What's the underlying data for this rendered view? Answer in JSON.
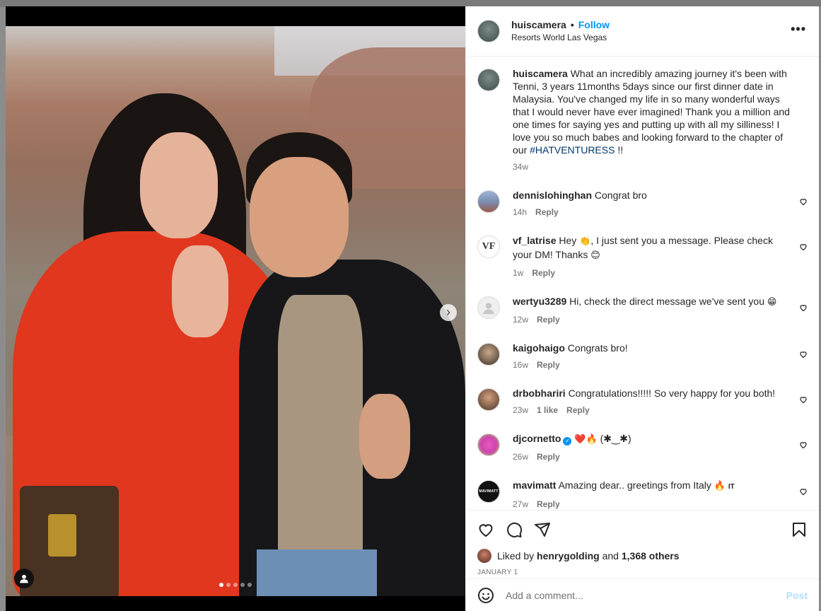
{
  "post": {
    "username": "huiscamera",
    "separator": "•",
    "follow_label": "Follow",
    "location": "Resorts World Las Vegas",
    "more_label": "•••"
  },
  "caption": {
    "username": "huiscamera",
    "text": "What an incredibly amazing journey it's been with Tenni, 3 years 11months 5days since our first dinner date in Malaysia. You've changed my life in so many wonderful ways that I would never have ever imagined! Thank you a million and one times for saying yes and putting up with all my silliness! I love you so much babes and looking forward to the chapter of our ",
    "hashtag": "#HATVENTURESS",
    "suffix": " !!",
    "time": "34w"
  },
  "comments": [
    {
      "username": "dennislohinghan",
      "text": "Congrat bro",
      "time": "14h",
      "reply": "Reply",
      "likes": ""
    },
    {
      "username": "vf_latrise",
      "text_a": "Hey",
      "emoji_a": "👏",
      "text_b": ", I just sent you a message. Please check your DM! Thanks",
      "emoji_b": "😊",
      "time": "1w",
      "reply": "Reply",
      "likes": "",
      "avatar_text": "VF"
    },
    {
      "username": "wertyu3289",
      "text": "Hi, check the direct message we've sent you",
      "emoji": "😁",
      "time": "12w",
      "reply": "Reply",
      "likes": ""
    },
    {
      "username": "kaigohaigo",
      "text": "Congrats bro!",
      "time": "16w",
      "reply": "Reply",
      "likes": ""
    },
    {
      "username": "drbobhariri",
      "text": "Congratulations!!!!! So very happy for you both!",
      "time": "23w",
      "reply": "Reply",
      "likes": "1 like"
    },
    {
      "username": "djcornetto",
      "verified": "✓",
      "emoji": "❤️🔥",
      "text": " (✱‿✱)",
      "time": "26w",
      "reply": "Reply",
      "likes": ""
    },
    {
      "username": "mavimatt",
      "text": "Amazing dear.. greetings from Italy",
      "emoji": "🔥",
      "flag": "IT",
      "time": "27w",
      "reply": "Reply",
      "likes": "",
      "avatar_text": "MAVIMATT"
    }
  ],
  "engagement": {
    "liked_by_prefix": "Liked by",
    "liked_by_user": "henrygolding",
    "and": "and",
    "others": "1,368 others",
    "date": "JANUARY 1"
  },
  "composer": {
    "placeholder": "Add a comment...",
    "post_label": "Post"
  },
  "carousel": {
    "slides": 5,
    "active_index": 0,
    "next_label": "›"
  },
  "icons": [
    "heart-icon",
    "comment-icon",
    "share-icon",
    "bookmark-icon",
    "smile-icon",
    "user-tag-icon",
    "more-icon"
  ],
  "colors": {
    "link_blue": "#0095f6",
    "hashtag": "#00376b",
    "muted": "#737373",
    "post_disabled": "#b2dffc"
  }
}
